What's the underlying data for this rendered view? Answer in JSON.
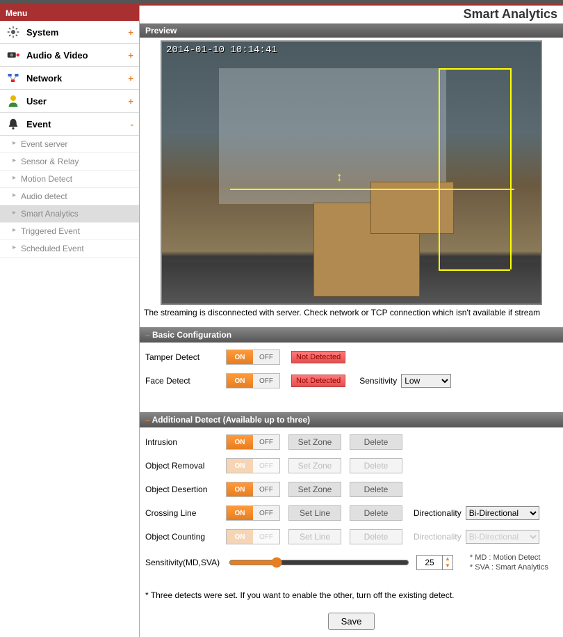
{
  "menu": {
    "header": "Menu",
    "items": [
      {
        "label": "System",
        "exp": "+"
      },
      {
        "label": "Audio & Video",
        "exp": "+"
      },
      {
        "label": "Network",
        "exp": "+"
      },
      {
        "label": "User",
        "exp": "+"
      },
      {
        "label": "Event",
        "exp": "-"
      }
    ],
    "event_sub": [
      "Event server",
      "Sensor & Relay",
      "Motion Detect",
      "Audio detect",
      "Smart Analytics",
      "Triggered Event",
      "Scheduled Event"
    ]
  },
  "page_title": "Smart Analytics",
  "preview": {
    "header": "Preview",
    "timestamp": "2014-01-10 10:14:41",
    "error": "The streaming is disconnected with server. Check network or TCP connection which isn't available if stream"
  },
  "basic": {
    "header": "Basic Configuration",
    "rows": {
      "tamper": {
        "label": "Tamper Detect",
        "state": "ON",
        "off": "OFF",
        "status": "Not Detected"
      },
      "face": {
        "label": "Face Detect",
        "state": "ON",
        "off": "OFF",
        "status": "Not Detected",
        "sens_label": "Sensitivity",
        "sens_value": "Low"
      }
    }
  },
  "add": {
    "header": "Additional Detect (Available up to three)",
    "btn_setzone": "Set Zone",
    "btn_setline": "Set  Line",
    "btn_delete": "Delete",
    "dir_label": "Directionality",
    "dir_value": "Bi-Directional",
    "rows": {
      "intrusion": {
        "label": "Intrusion",
        "enabled": true,
        "zone": true
      },
      "removal": {
        "label": "Object Removal",
        "enabled": false,
        "zone": true
      },
      "desertion": {
        "label": "Object Desertion",
        "enabled": true,
        "zone": true
      },
      "crossing": {
        "label": "Crossing Line",
        "enabled": true,
        "zone": false,
        "dir": true
      },
      "counting": {
        "label": "Object Counting",
        "enabled": false,
        "zone": false,
        "dir": true
      }
    },
    "sens_label": "Sensitivity(MD,SVA)",
    "sens_value": "25",
    "legend1": "* MD : Motion Detect",
    "legend2": "* SVA : Smart Analytics",
    "note": "* Three detects were set. If you want to enable the other, turn off the existing detect.",
    "save": "Save"
  },
  "toggle_labels": {
    "on": "ON",
    "off": "OFF"
  }
}
